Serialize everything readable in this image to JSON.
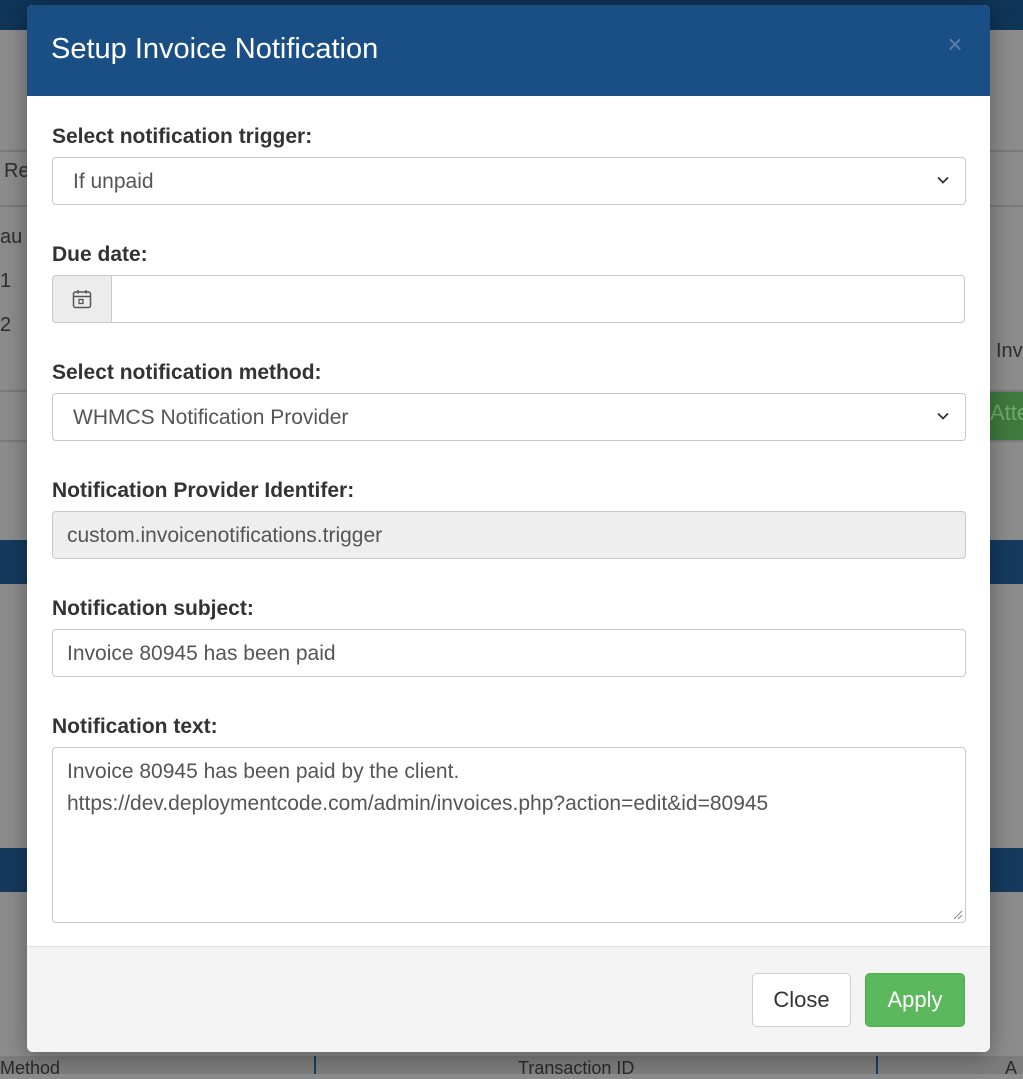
{
  "background": {
    "fragments": [
      "Re",
      "au",
      "1",
      "2",
      "Inv",
      "Atte"
    ],
    "footer_columns": [
      "Method",
      "Transaction ID",
      "A"
    ]
  },
  "modal": {
    "title": "Setup Invoice Notification",
    "close_symbol": "×",
    "fields": {
      "trigger": {
        "label": "Select notification trigger:",
        "value": "If unpaid"
      },
      "due_date": {
        "label": "Due date:",
        "value": ""
      },
      "method": {
        "label": "Select notification method:",
        "value": "WHMCS Notification Provider"
      },
      "identifier": {
        "label": "Notification Provider Identifer:",
        "value": "custom.invoicenotifications.trigger"
      },
      "subject": {
        "label": "Notification subject:",
        "value": "Invoice 80945 has been paid"
      },
      "text": {
        "label": "Notification text:",
        "line1": "Invoice 80945 has been paid by the client.",
        "line2": "https://dev.deploymentcode.com/admin/invoices.php?action=edit&id=80945"
      }
    },
    "buttons": {
      "close": "Close",
      "apply": "Apply"
    }
  },
  "icons": [
    "calendar-icon",
    "chevron-down-icon",
    "close-icon",
    "resize-handle-icon"
  ]
}
